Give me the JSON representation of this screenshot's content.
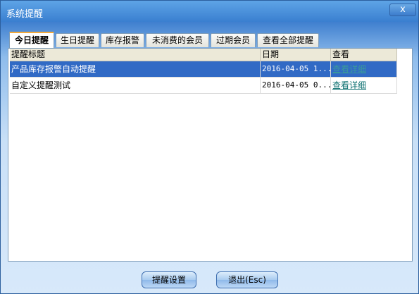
{
  "window": {
    "title": "系统提醒",
    "close_glyph": "x"
  },
  "tabs": [
    {
      "label": "今日提醒",
      "active": true
    },
    {
      "label": "生日提醒",
      "active": false
    },
    {
      "label": "库存报警",
      "active": false
    },
    {
      "label": "未消费的会员",
      "active": false
    },
    {
      "label": "过期会员",
      "active": false
    },
    {
      "label": "查看全部提醒",
      "active": false
    }
  ],
  "grid": {
    "columns": [
      "提醒标题",
      "日期",
      "查看"
    ],
    "rows": [
      {
        "title": "产品库存报警自动提醒",
        "date": "2016-04-05 1...",
        "action": "查看详细",
        "selected": true
      },
      {
        "title": "自定义提醒测试",
        "date": "2016-04-05 0...",
        "action": "查看详细",
        "selected": false
      }
    ]
  },
  "buttons": {
    "settings": "提醒设置",
    "exit": "退出(Esc)"
  },
  "colors": {
    "selection": "#316ac5",
    "link": "#0a6f6f",
    "active_tab_accent": "#f2a83a"
  }
}
